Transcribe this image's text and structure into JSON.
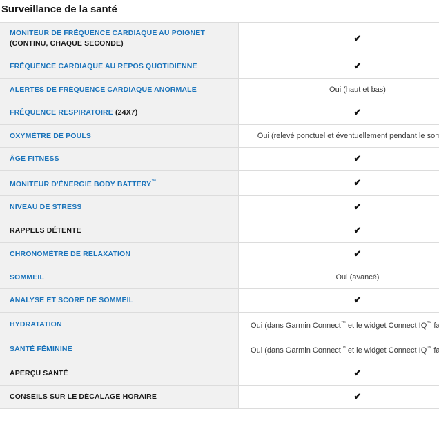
{
  "header": {
    "title": "Surveillance de la santé"
  },
  "colors": {
    "accent_blue": "#1b74bb",
    "text_dark": "#1a1a1a",
    "row_label_bg": "#f1f1f1",
    "row_value_bg": "#ffffff",
    "border": "#dcdcdc"
  },
  "glyphs": {
    "check": "✔",
    "trademark": "™"
  },
  "table": {
    "rows": [
      {
        "label_accent": "MONITEUR DE FRÉQUENCE CARDIAQUE AU POIGNET",
        "label_plain": "(CONTINU, CHAQUE SECONDE)",
        "label_layout": "two-line",
        "value_type": "check",
        "value": "✔"
      },
      {
        "label_accent": "FRÉQUENCE CARDIAQUE AU REPOS QUOTIDIENNE",
        "label_plain": "",
        "label_layout": "single",
        "value_type": "check",
        "value": "✔"
      },
      {
        "label_accent": "ALERTES DE FRÉQUENCE CARDIAQUE ANORMALE",
        "label_plain": "",
        "label_layout": "single",
        "value_type": "text",
        "value": "Oui (haut et bas)"
      },
      {
        "label_accent": "FRÉQUENCE RESPIRATOIRE",
        "label_plain": "(24X7)",
        "label_layout": "inline",
        "value_type": "check",
        "value": "✔"
      },
      {
        "label_accent": "OXYMÈTRE DE POULS",
        "label_plain": "",
        "label_layout": "single",
        "value_type": "text",
        "value": "Oui (relevé ponctuel et éventuellement pendant le sommeil)"
      },
      {
        "label_accent": "ÂGE FITNESS",
        "label_plain": "",
        "label_layout": "single",
        "value_type": "check",
        "value": "✔"
      },
      {
        "label_accent": "MONITEUR D'ÉNERGIE BODY BATTERY™",
        "label_plain": "",
        "label_layout": "single",
        "value_type": "check",
        "value": "✔"
      },
      {
        "label_accent": "NIVEAU DE STRESS",
        "label_plain": "",
        "label_layout": "single",
        "value_type": "check",
        "value": "✔"
      },
      {
        "label_accent": "",
        "label_plain": "RAPPELS DÉTENTE",
        "label_layout": "single-plain",
        "value_type": "check",
        "value": "✔"
      },
      {
        "label_accent": "CHRONOMÈTRE DE RELAXATION",
        "label_plain": "",
        "label_layout": "single",
        "value_type": "check",
        "value": "✔"
      },
      {
        "label_accent": "SOMMEIL",
        "label_plain": "",
        "label_layout": "single",
        "value_type": "text",
        "value": "Oui (avancé)"
      },
      {
        "label_accent": "ANALYSE ET SCORE DE SOMMEIL",
        "label_plain": "",
        "label_layout": "single",
        "value_type": "check",
        "value": "✔"
      },
      {
        "label_accent": "HYDRATATION",
        "label_plain": "",
        "label_layout": "single",
        "value_type": "text",
        "value": "Oui (dans Garmin Connect™ et le widget Connect IQ™ facultatif)"
      },
      {
        "label_accent": "SANTÉ FÉMININE",
        "label_plain": "",
        "label_layout": "single",
        "value_type": "text",
        "value": "Oui (dans Garmin Connect™ et le widget Connect IQ™ facultatif)"
      },
      {
        "label_accent": "",
        "label_plain": "APERÇU SANTÉ",
        "label_layout": "single-plain",
        "value_type": "check",
        "value": "✔"
      },
      {
        "label_accent": "",
        "label_plain": "CONSEILS SUR LE DÉCALAGE HORAIRE",
        "label_layout": "single-plain",
        "value_type": "check",
        "value": "✔"
      }
    ]
  }
}
